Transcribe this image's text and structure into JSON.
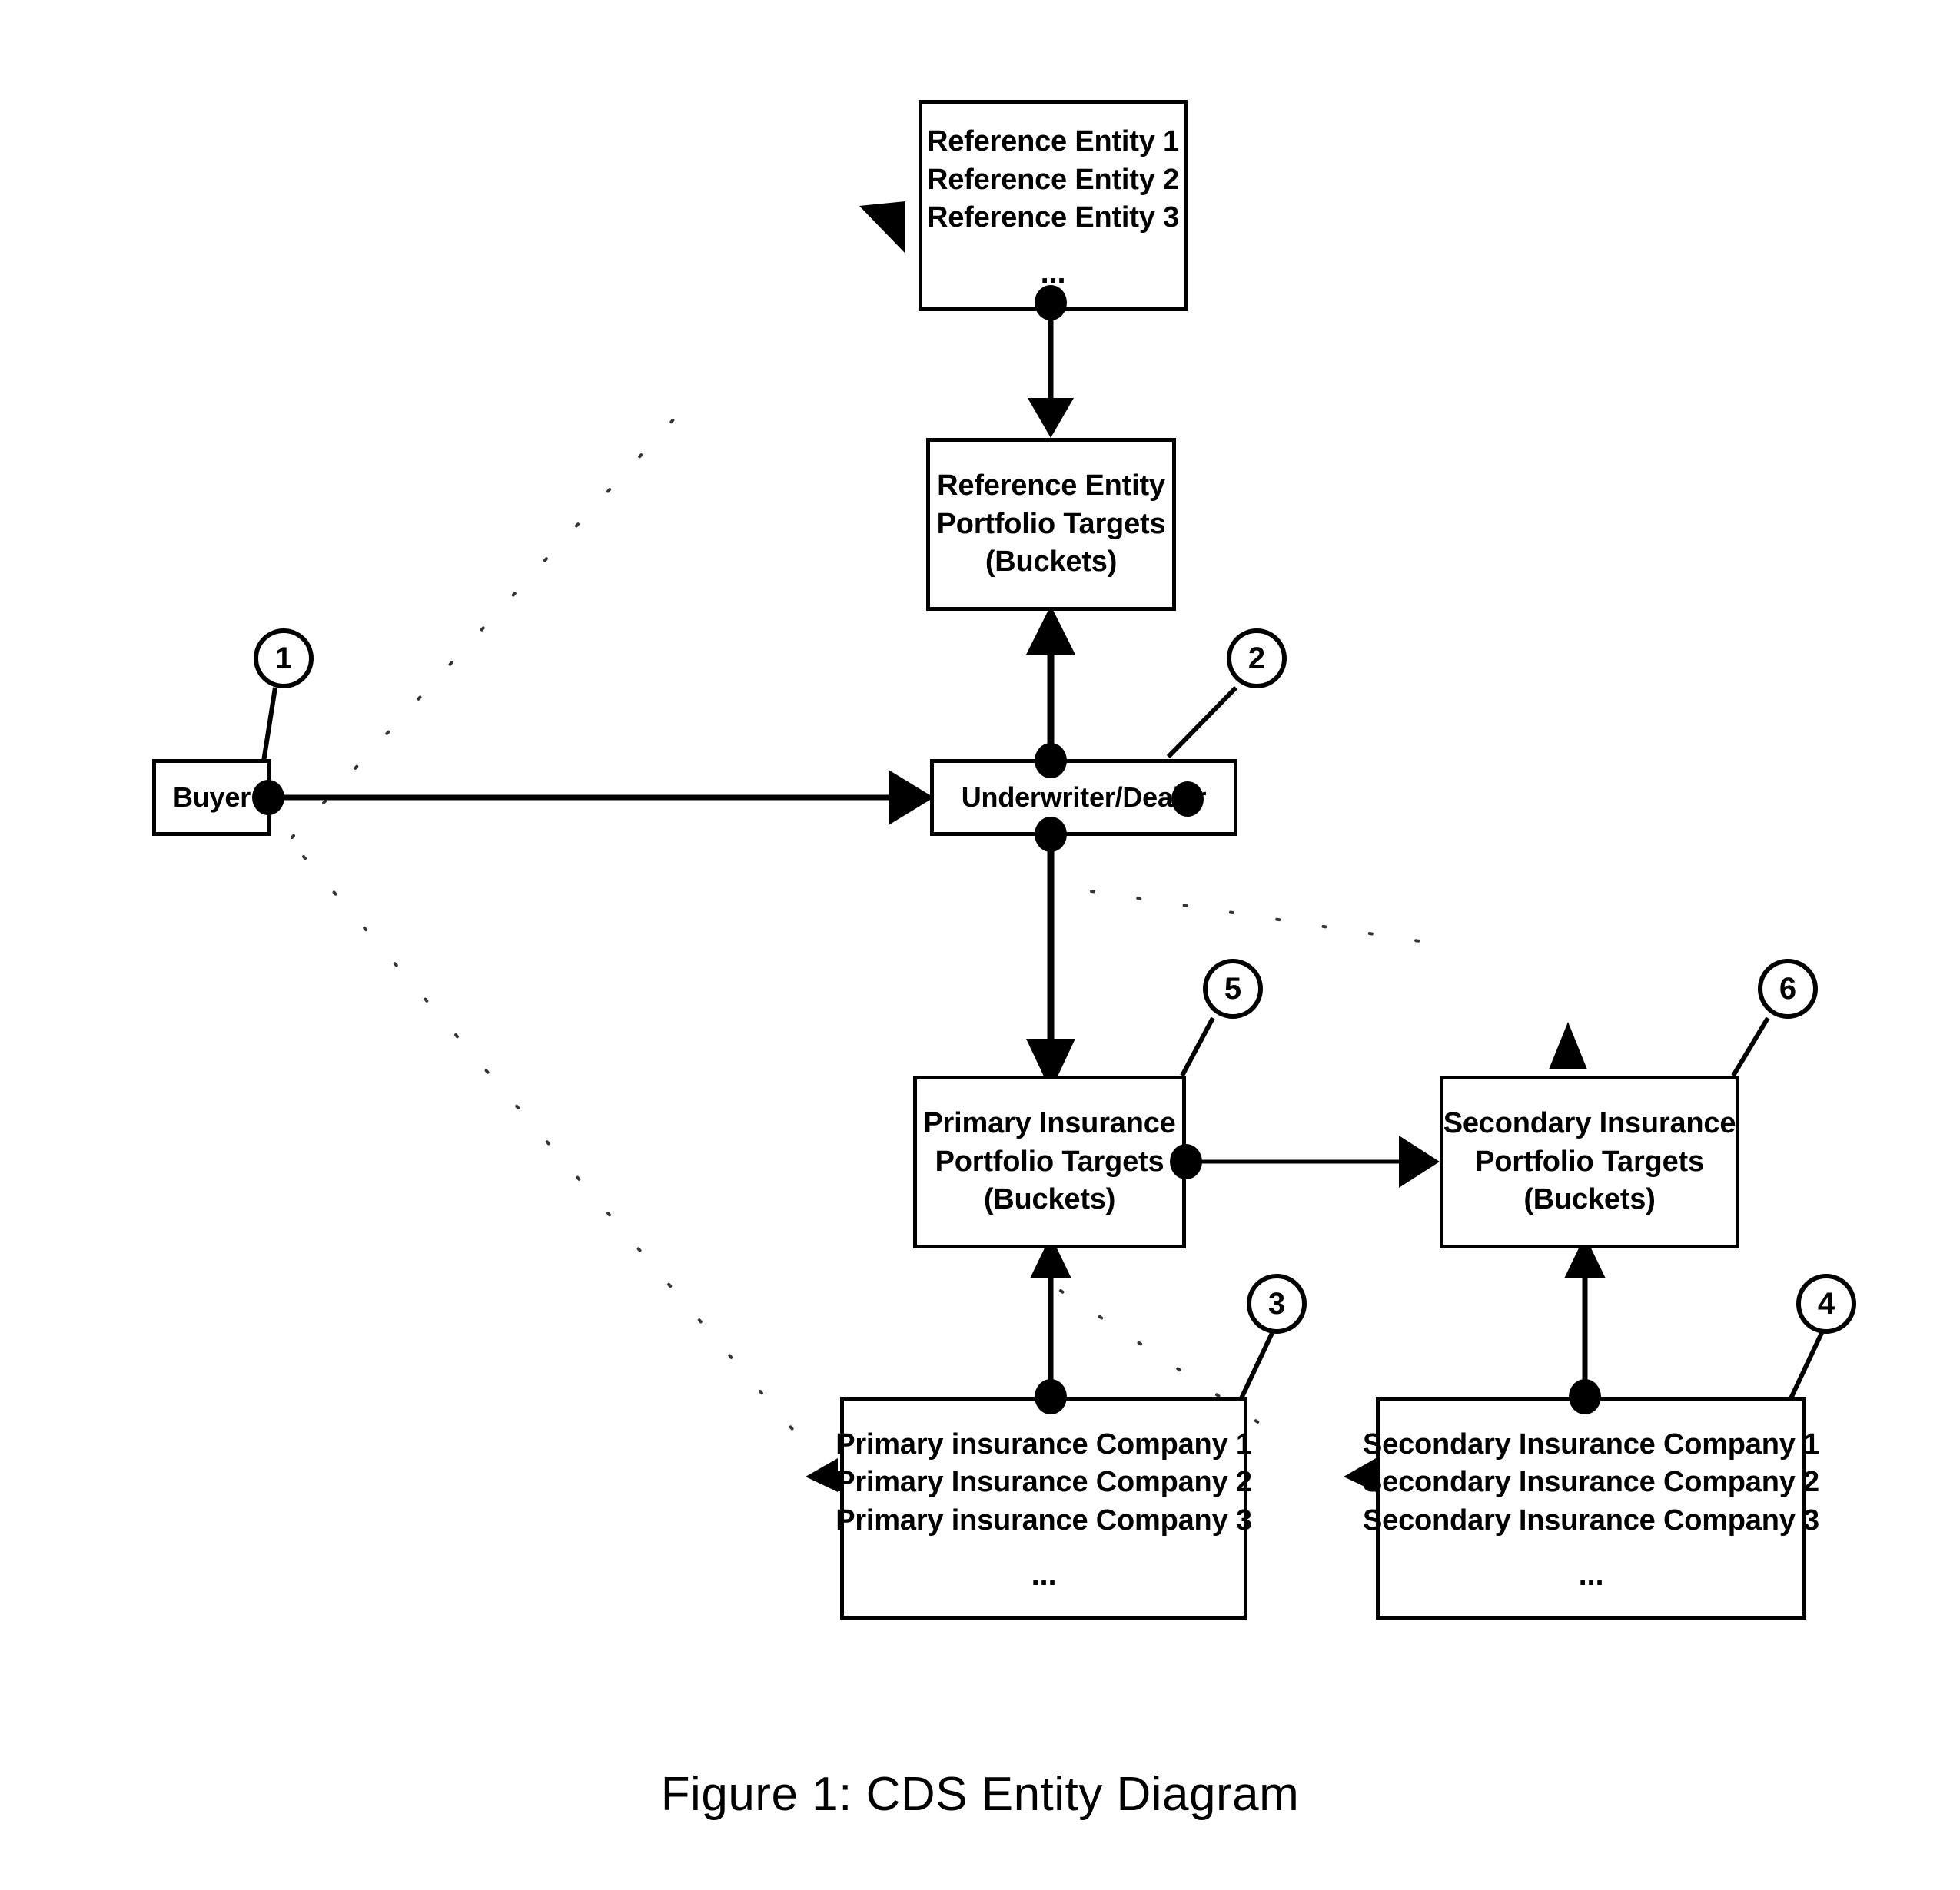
{
  "figure": {
    "caption": "Figure 1: CDS Entity Diagram",
    "ellipsis": "..."
  },
  "nodes": {
    "reference_entities": {
      "name": "reference-entities-list",
      "lines": [
        "Reference Entity 1",
        "Reference Entity 2",
        "Reference Entity 3"
      ],
      "ellipsis": "..."
    },
    "reference_portfolio": {
      "name": "reference-entity-portfolio-targets",
      "lines": [
        "Reference Entity",
        "Portfolio Targets",
        "(Buckets)"
      ]
    },
    "buyer": {
      "name": "buyer",
      "label": "Buyer"
    },
    "underwriter": {
      "name": "underwriter-dealer",
      "label": "Underwriter/Dealer"
    },
    "primary_portfolio": {
      "name": "primary-insurance-portfolio-targets",
      "lines": [
        "Primary Insurance",
        "Portfolio Targets",
        "(Buckets)"
      ]
    },
    "secondary_portfolio": {
      "name": "secondary-insurance-portfolio-targets",
      "lines": [
        "Secondary Insurance",
        "Portfolio Targets",
        "(Buckets)"
      ]
    },
    "primary_companies": {
      "name": "primary-insurance-companies-list",
      "lines": [
        "Primary insurance Company 1",
        "Primary Insurance Company 2",
        "Primary insurance Company 3"
      ],
      "ellipsis": "..."
    },
    "secondary_companies": {
      "name": "secondary-insurance-companies-list",
      "lines": [
        "Secondary Insurance Company 1",
        "Secondary Insurance Company 2",
        "Secondary Insurance Company 3"
      ],
      "ellipsis": "..."
    }
  },
  "callouts": [
    {
      "id": "callout-1",
      "label": "1",
      "target": "buyer"
    },
    {
      "id": "callout-2",
      "label": "2",
      "target": "underwriter-dealer"
    },
    {
      "id": "callout-3",
      "label": "3",
      "target": "primary-insurance-companies-list"
    },
    {
      "id": "callout-4",
      "label": "4",
      "target": "secondary-insurance-companies-list"
    },
    {
      "id": "callout-5",
      "label": "5",
      "target": "primary-insurance-portfolio-targets"
    },
    {
      "id": "callout-6",
      "label": "6",
      "target": "secondary-insurance-portfolio-targets"
    }
  ],
  "colors": {
    "stroke": "#000000",
    "fill": "#ffffff",
    "text": "#000000"
  }
}
